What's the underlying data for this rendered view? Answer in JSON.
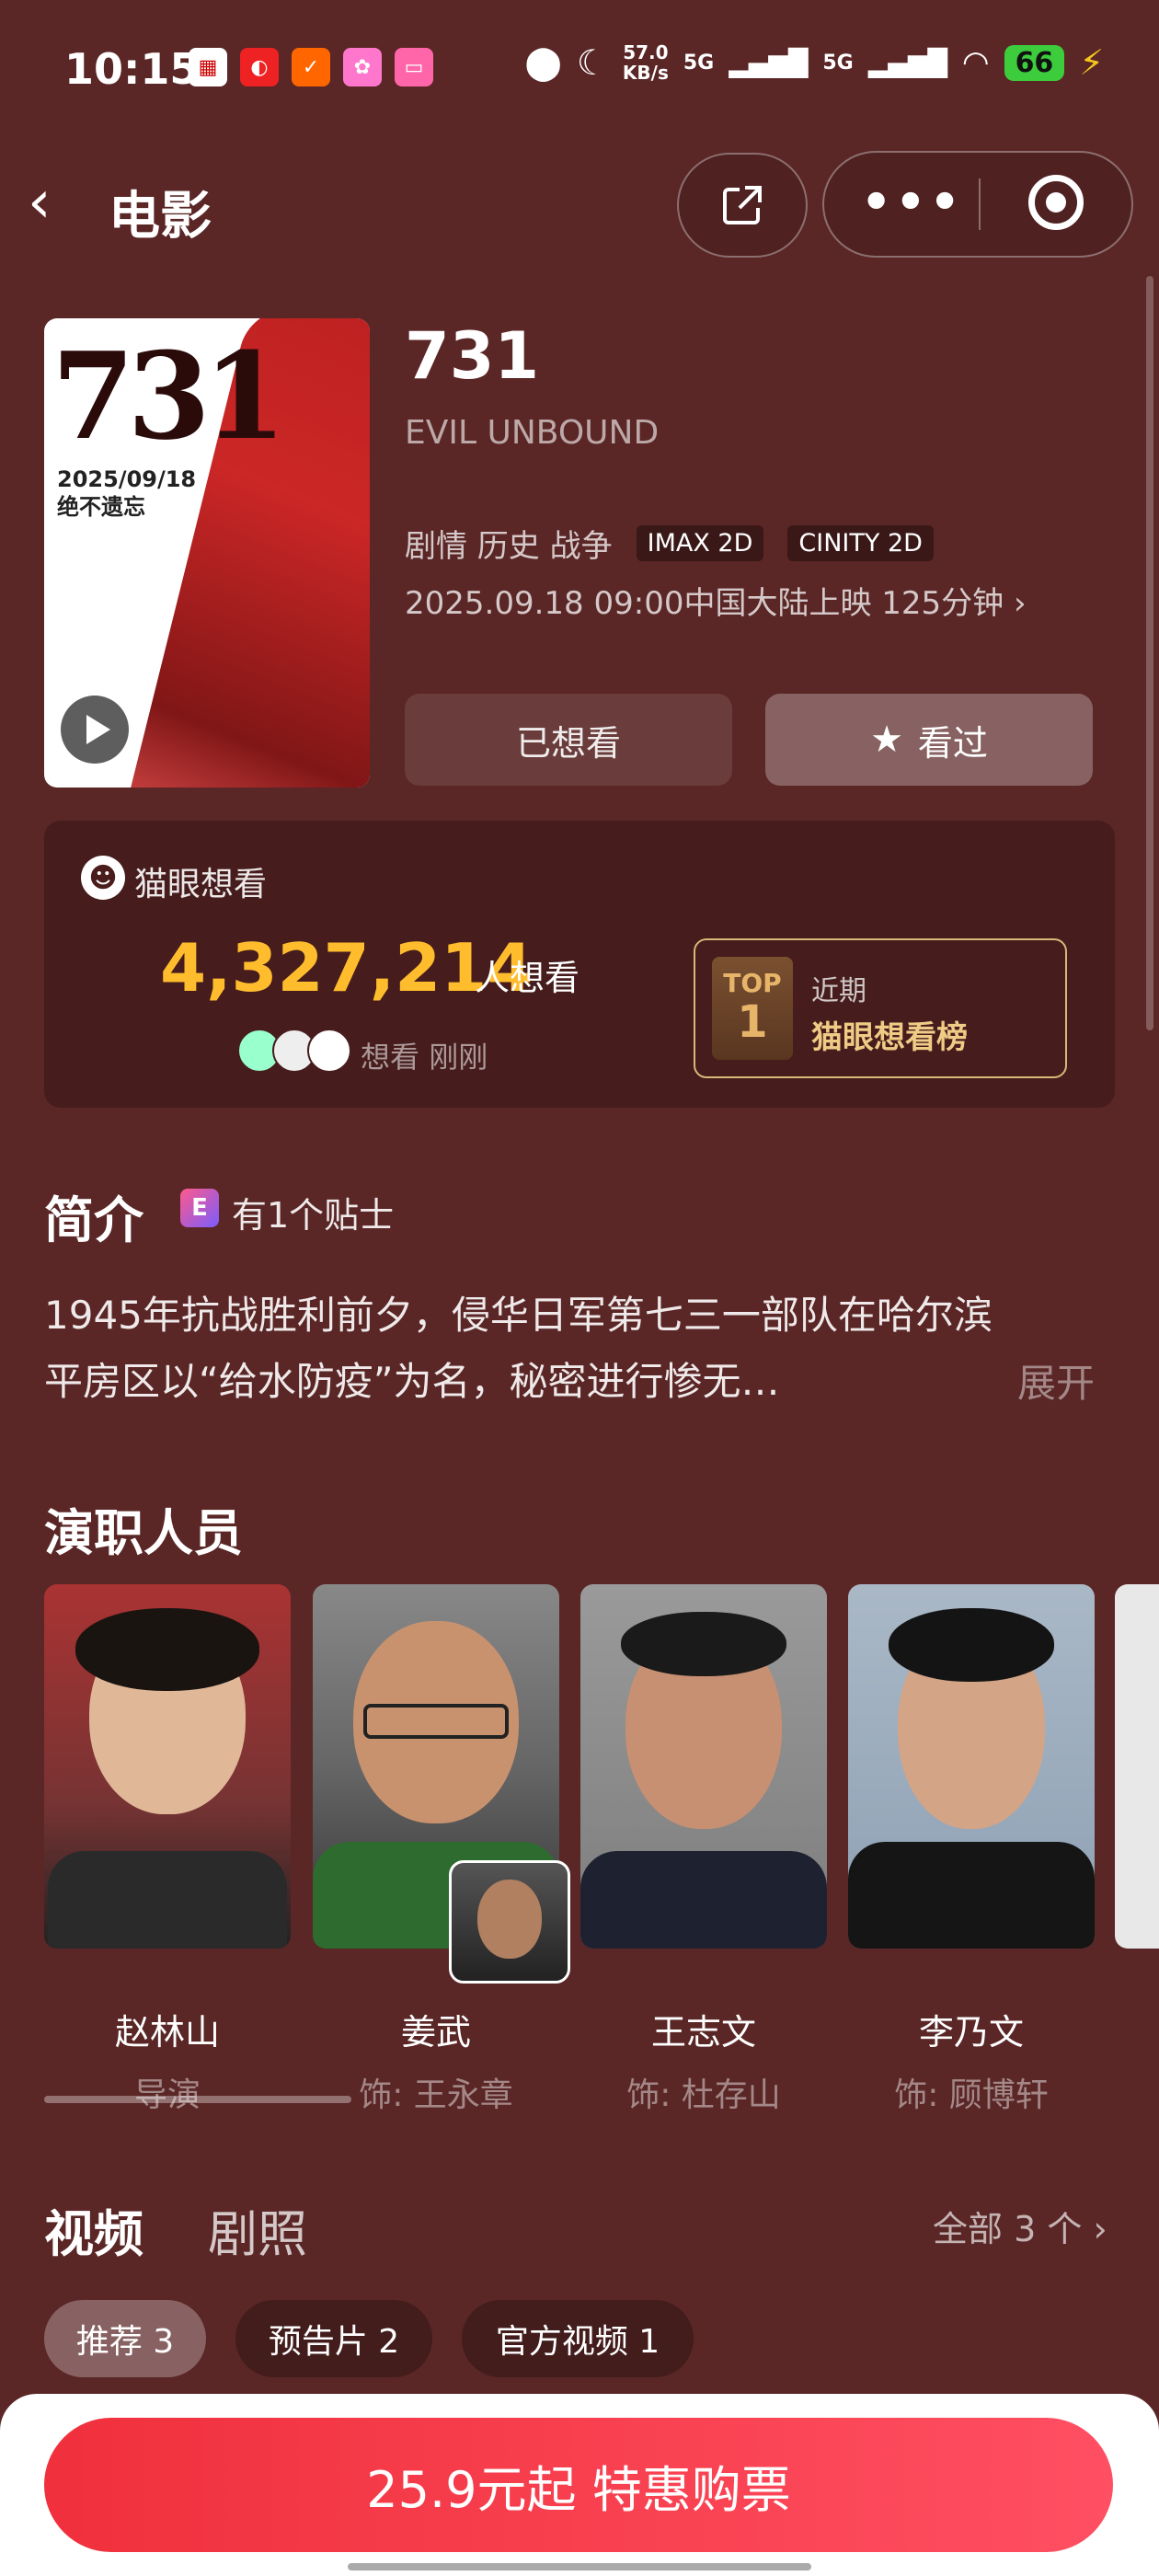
{
  "status_bar": {
    "time": "10:15",
    "net_speed": "57.0",
    "net_unit": "KB/s",
    "signal1": "5G",
    "signal2": "5G",
    "battery": "66"
  },
  "header": {
    "title": "电影"
  },
  "movie": {
    "poster_number": "731",
    "poster_date": "2025/09/18",
    "poster_slogan": "绝不遗忘",
    "title": "731",
    "subtitle": "EVIL UNBOUND",
    "genres": "剧情 历史 战争",
    "format_tags": [
      "IMAX 2D",
      "CINITY 2D"
    ],
    "release": "2025.09.18 09:00中国大陆上映 125分钟",
    "want_button": "已想看",
    "seen_button": "看过"
  },
  "want": {
    "label": "猫眼想看",
    "count": "4,327,214",
    "count_suffix": "人想看",
    "recent_label": "想看",
    "recent_time": "刚刚",
    "rank_top_label": "TOP",
    "rank_number": "1",
    "rank_period": "近期",
    "rank_list": "猫眼想看榜"
  },
  "intro": {
    "heading": "简介",
    "tip_icon_text": "E",
    "tip_text": "有1个贴士",
    "synopsis": "1945年抗战胜利前夕，侵华日军第七三一部队在哈尔滨平房区以“给水防疫”为名，秘密进行惨无…",
    "expand": "展开"
  },
  "cast": {
    "heading": "演职人员",
    "members": [
      {
        "name": "赵林山",
        "role": "导演"
      },
      {
        "name": "姜武",
        "role": "饰: 王永章"
      },
      {
        "name": "王志文",
        "role": "饰: 杜存山"
      },
      {
        "name": "李乃文",
        "role": "饰: 顾博轩"
      }
    ]
  },
  "videos": {
    "tab_video": "视频",
    "tab_photo": "剧照",
    "all_link": "全部 3 个",
    "chips": [
      {
        "label": "推荐 3"
      },
      {
        "label": "预告片 2"
      },
      {
        "label": "官方视频 1"
      }
    ]
  },
  "buy": {
    "label": "25.9元起 特惠购票"
  },
  "colors": {
    "background": "#5a2626",
    "want_count": "#ffbd2e",
    "buy_button": "#f0303c",
    "rank_border": "#d9b87a"
  }
}
